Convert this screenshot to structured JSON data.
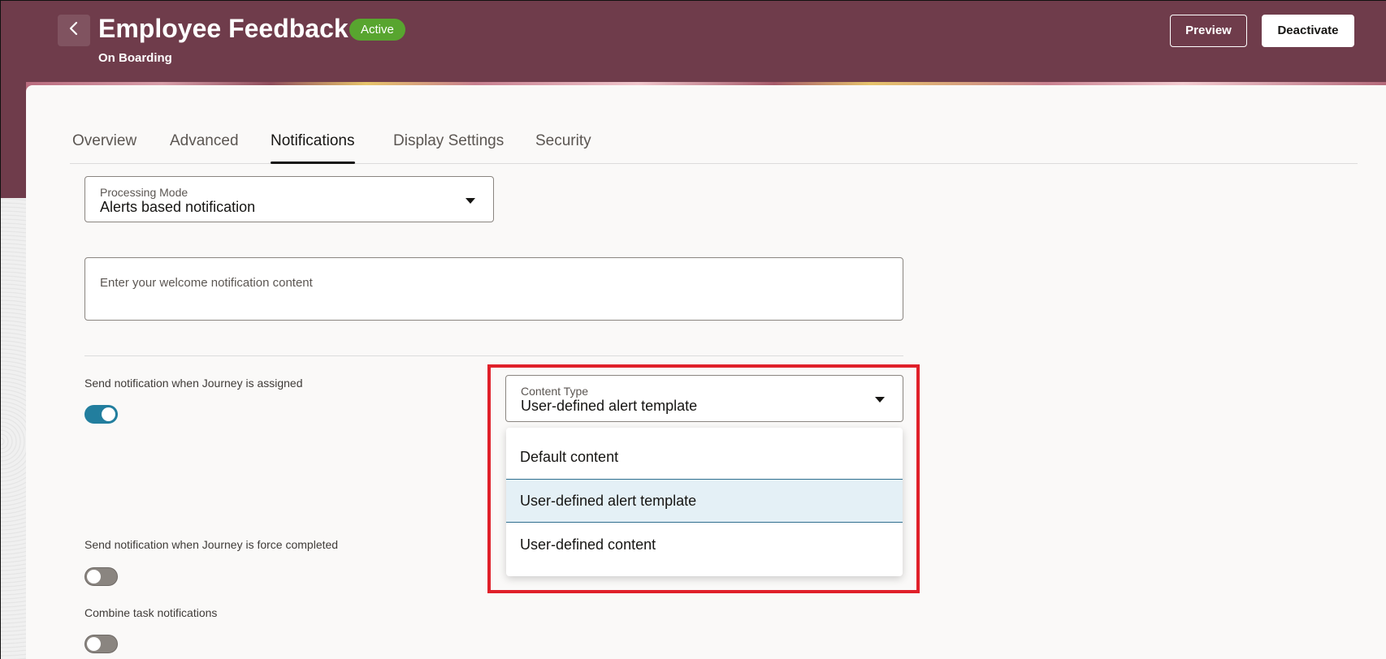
{
  "header": {
    "title": "Employee Feedback",
    "status": "Active",
    "subtitle": "On Boarding",
    "back_icon": "chevron-left-icon",
    "preview_label": "Preview",
    "deactivate_label": "Deactivate"
  },
  "tabs": [
    {
      "label": "Overview",
      "active": false
    },
    {
      "label": "Advanced",
      "active": false
    },
    {
      "label": "Notifications",
      "active": true
    },
    {
      "label": "Display Settings",
      "active": false
    },
    {
      "label": "Security",
      "active": false
    }
  ],
  "processing_mode": {
    "label": "Processing Mode",
    "value": "Alerts based notification"
  },
  "welcome_content": {
    "placeholder": "Enter your welcome notification content"
  },
  "notifications": {
    "assigned": {
      "label": "Send notification when Journey is assigned",
      "enabled": true
    },
    "force_completed": {
      "label": "Send notification when Journey is force completed",
      "enabled": false
    },
    "combine": {
      "label": "Combine task notifications",
      "enabled": false
    }
  },
  "content_type": {
    "label": "Content Type",
    "value": "User-defined alert template",
    "options": [
      {
        "label": "Default content",
        "selected": false
      },
      {
        "label": "User-defined alert template",
        "selected": true
      },
      {
        "label": "User-defined content",
        "selected": false
      }
    ]
  },
  "colors": {
    "header_bg": "#6f3c4b",
    "badge_green": "#58a52f",
    "toggle_on": "#227e9e",
    "highlight_red": "#e0202a",
    "selected_bg": "#e4f0f6"
  }
}
